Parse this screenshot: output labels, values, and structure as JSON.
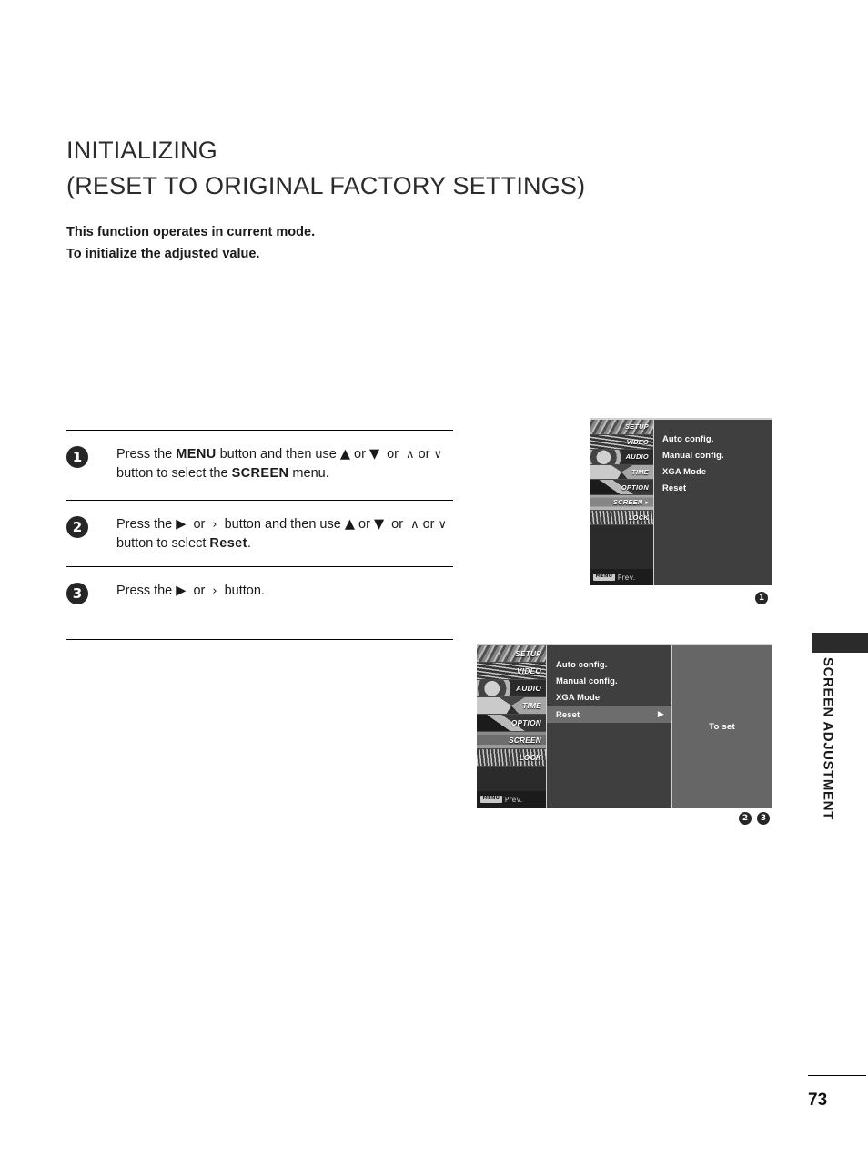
{
  "page": {
    "number": "73",
    "side_tab": "SCREEN ADJUSTMENT"
  },
  "title": {
    "line1": "INITIALIZING",
    "line2": "(RESET TO ORIGINAL FACTORY SETTINGS)"
  },
  "intro": {
    "line1": "This function operates in current mode.",
    "line2": "To initialize the adjusted value."
  },
  "steps": [
    {
      "number": "1",
      "text_a": "Press the ",
      "bold_a": "MENU",
      "text_b": " button and then use ",
      "up_solid": "▲",
      "or_1": " or ",
      "down_solid": "▼",
      "or_2": " or ",
      "up_thin": "∧",
      "or_3": " or ",
      "down_thin": "∨",
      "text_c": " button to select the ",
      "bold_b": "SCREEN",
      "text_d": " menu."
    },
    {
      "number": "2",
      "text_a": "Press the ",
      "right_solid": "▶",
      "or_1": " or ",
      "right_thin": "›",
      "text_b": " button and then use ",
      "up_solid": "▲",
      "or_2": " or ",
      "down_solid": "▼",
      "or_3": " or ",
      "up_thin": "∧",
      "or_4": " or ",
      "down_thin": "∨",
      "text_c": " button to select ",
      "bold_a": "Reset",
      "text_d": "."
    },
    {
      "number": "3",
      "text_a": "Press the ",
      "right_solid": "▶",
      "or_1": " or ",
      "right_thin": "›",
      "text_b": " button."
    }
  ],
  "osd": {
    "sidebar_items": [
      "SETUP",
      "VIDEO",
      "AUDIO",
      "TIME",
      "OPTION",
      "SCREEN",
      "LOCK"
    ],
    "menu_chip": "MENU",
    "prev_label": "Prev.",
    "active_item": "SCREEN",
    "screen_1": {
      "rows": [
        "Auto config.",
        "Manual config.",
        "XGA Mode",
        "Reset"
      ],
      "marker": "1"
    },
    "screen_2": {
      "rows": [
        "Auto config.",
        "Manual config.",
        "XGA Mode"
      ],
      "selected_row": "Reset",
      "selected_arrow": "▶",
      "right_panel": "To set",
      "markers": [
        "2",
        "3"
      ]
    }
  },
  "colors": {
    "osd_background": "#3f3f3f",
    "osd_highlight": "#6d6d6d",
    "osd_right_panel": "#666666",
    "text_dark": "#1a1a1a"
  }
}
